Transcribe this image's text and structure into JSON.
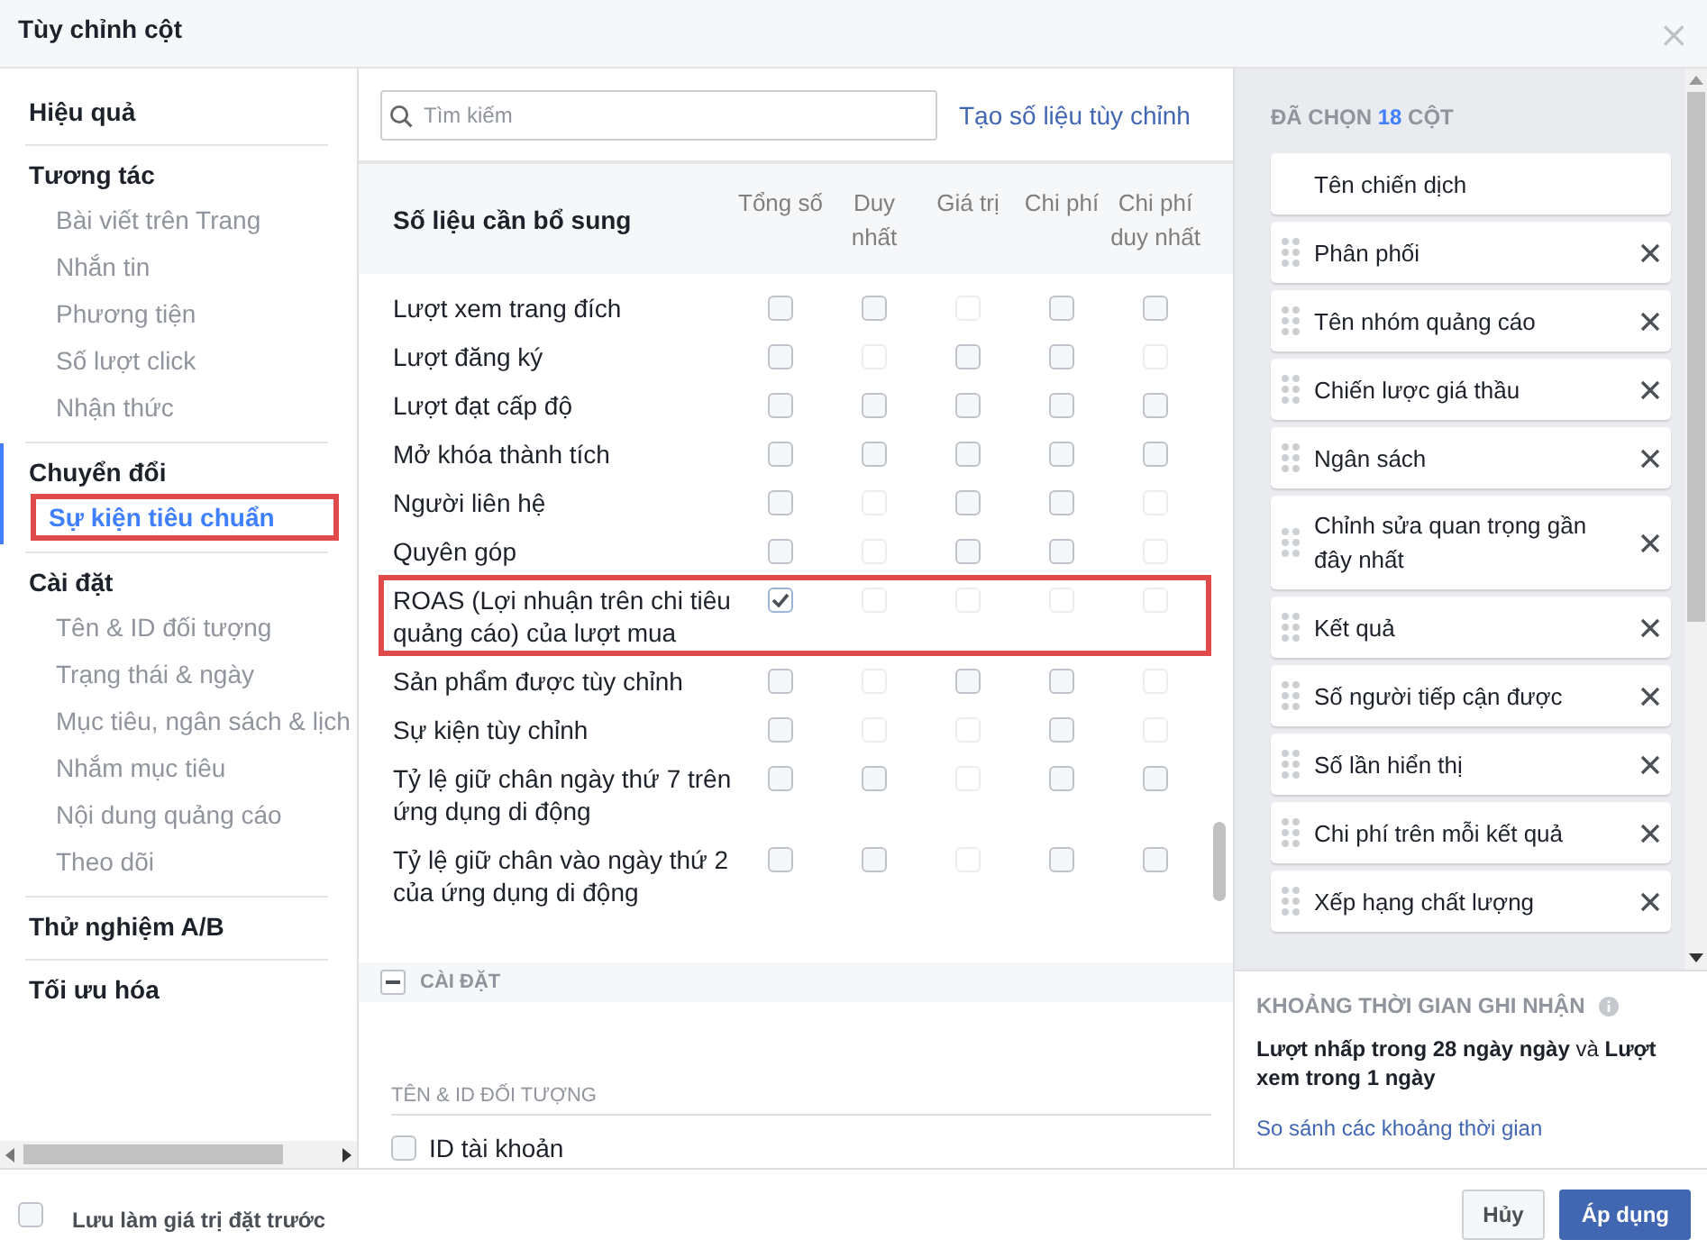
{
  "window": {
    "title": "Tùy chỉnh cột",
    "close": "×"
  },
  "sidebar": {
    "groups": [
      {
        "label": "Hiệu quả"
      },
      {
        "label": "Tương tác",
        "items": [
          {
            "label": "Bài viết trên Trang",
            "selected": false,
            "highlighted": false
          },
          {
            "label": "Nhắn tin",
            "selected": false,
            "highlighted": false
          },
          {
            "label": "Phương tiện",
            "selected": false,
            "highlighted": false
          },
          {
            "label": "Số lượt click",
            "selected": false,
            "highlighted": false
          },
          {
            "label": "Nhận thức",
            "selected": false,
            "highlighted": false
          }
        ]
      },
      {
        "label": "Chuyển đổi",
        "items": [
          {
            "label": "Sự kiện tiêu chuẩn",
            "selected": true,
            "highlighted": true
          }
        ]
      },
      {
        "label": "Cài đặt",
        "items": [
          {
            "label": "Tên & ID đối tượng",
            "selected": false,
            "highlighted": false
          },
          {
            "label": "Trạng thái & ngày",
            "selected": false,
            "highlighted": false
          },
          {
            "label": "Mục tiêu, ngân sách & lịch",
            "selected": false,
            "highlighted": false
          },
          {
            "label": "Nhắm mục tiêu",
            "selected": false,
            "highlighted": false
          },
          {
            "label": "Nội dung quảng cáo",
            "selected": false,
            "highlighted": false
          },
          {
            "label": "Theo dõi",
            "selected": false,
            "highlighted": false
          }
        ]
      },
      {
        "label": "Thử nghiệm A/B"
      },
      {
        "label": "Tối ưu hóa"
      }
    ]
  },
  "search": {
    "placeholder": "Tìm kiếm",
    "create_link": "Tạo số liệu tùy chỉnh"
  },
  "table": {
    "title": "Số liệu cần bổ sung",
    "columns": [
      "Tổng số",
      "Duy nhất",
      "Giá trị",
      "Chi phí",
      "Chi phí duy nhất"
    ],
    "rows": [
      {
        "label": "Lượt xem trang đích",
        "highlighted": false,
        "cells": [
          {
            "checked": false,
            "disabled": false
          },
          {
            "checked": false,
            "disabled": false
          },
          {
            "checked": false,
            "disabled": true
          },
          {
            "checked": false,
            "disabled": false
          },
          {
            "checked": false,
            "disabled": false
          }
        ]
      },
      {
        "label": "Lượt đăng ký",
        "highlighted": false,
        "cells": [
          {
            "checked": false,
            "disabled": false
          },
          {
            "checked": false,
            "disabled": true
          },
          {
            "checked": false,
            "disabled": false
          },
          {
            "checked": false,
            "disabled": false
          },
          {
            "checked": false,
            "disabled": true
          }
        ]
      },
      {
        "label": "Lượt đạt cấp độ",
        "highlighted": false,
        "cells": [
          {
            "checked": false,
            "disabled": false
          },
          {
            "checked": false,
            "disabled": false
          },
          {
            "checked": false,
            "disabled": false
          },
          {
            "checked": false,
            "disabled": false
          },
          {
            "checked": false,
            "disabled": false
          }
        ]
      },
      {
        "label": "Mở khóa thành tích",
        "highlighted": false,
        "cells": [
          {
            "checked": false,
            "disabled": false
          },
          {
            "checked": false,
            "disabled": false
          },
          {
            "checked": false,
            "disabled": false
          },
          {
            "checked": false,
            "disabled": false
          },
          {
            "checked": false,
            "disabled": false
          }
        ]
      },
      {
        "label": "Người liên hệ",
        "highlighted": false,
        "cells": [
          {
            "checked": false,
            "disabled": false
          },
          {
            "checked": false,
            "disabled": true
          },
          {
            "checked": false,
            "disabled": false
          },
          {
            "checked": false,
            "disabled": false
          },
          {
            "checked": false,
            "disabled": true
          }
        ]
      },
      {
        "label": "Quyên góp",
        "highlighted": false,
        "cells": [
          {
            "checked": false,
            "disabled": false
          },
          {
            "checked": false,
            "disabled": true
          },
          {
            "checked": false,
            "disabled": false
          },
          {
            "checked": false,
            "disabled": false
          },
          {
            "checked": false,
            "disabled": true
          }
        ]
      },
      {
        "label": "ROAS (Lợi nhuận trên chi tiêu quảng cáo) của lượt mua",
        "highlighted": true,
        "cells": [
          {
            "checked": true,
            "disabled": false
          },
          {
            "checked": false,
            "disabled": true
          },
          {
            "checked": false,
            "disabled": true
          },
          {
            "checked": false,
            "disabled": true
          },
          {
            "checked": false,
            "disabled": true
          }
        ]
      },
      {
        "label": "Sản phẩm được tùy chỉnh",
        "highlighted": false,
        "cells": [
          {
            "checked": false,
            "disabled": false
          },
          {
            "checked": false,
            "disabled": true
          },
          {
            "checked": false,
            "disabled": false
          },
          {
            "checked": false,
            "disabled": false
          },
          {
            "checked": false,
            "disabled": true
          }
        ]
      },
      {
        "label": "Sự kiện tùy chỉnh",
        "highlighted": false,
        "cells": [
          {
            "checked": false,
            "disabled": false
          },
          {
            "checked": false,
            "disabled": true
          },
          {
            "checked": false,
            "disabled": true
          },
          {
            "checked": false,
            "disabled": false
          },
          {
            "checked": false,
            "disabled": true
          }
        ]
      },
      {
        "label": "Tỷ lệ giữ chân ngày thứ 7 trên ứng dụng di động",
        "highlighted": false,
        "cells": [
          {
            "checked": false,
            "disabled": false
          },
          {
            "checked": false,
            "disabled": false
          },
          {
            "checked": false,
            "disabled": true
          },
          {
            "checked": false,
            "disabled": false
          },
          {
            "checked": false,
            "disabled": false
          }
        ]
      },
      {
        "label": "Tỷ lệ giữ chân vào ngày thứ 2 của ứng dụng di động",
        "highlighted": false,
        "cells": [
          {
            "checked": false,
            "disabled": false
          },
          {
            "checked": false,
            "disabled": false
          },
          {
            "checked": false,
            "disabled": true
          },
          {
            "checked": false,
            "disabled": false
          },
          {
            "checked": false,
            "disabled": false
          }
        ]
      }
    ]
  },
  "section": {
    "title": "CÀI ĐẶT",
    "expanded": true,
    "subheading": "TÊN & ID ĐỐI TƯỢNG",
    "options": [
      {
        "label": "ID tài khoản",
        "checked": false
      }
    ]
  },
  "selected_columns": {
    "prefix": "ĐÃ CHỌN",
    "count": "18",
    "suffix": "CỘT",
    "items": [
      {
        "label": "Tên chiến dịch",
        "removable": false
      },
      {
        "label": "Phân phối",
        "removable": true
      },
      {
        "label": "Tên nhóm quảng cáo",
        "removable": true
      },
      {
        "label": "Chiến lược giá thầu",
        "removable": true
      },
      {
        "label": "Ngân sách",
        "removable": true
      },
      {
        "label": "Chỉnh sửa quan trọng gần đây nhất",
        "removable": true
      },
      {
        "label": "Kết quả",
        "removable": true
      },
      {
        "label": "Số người tiếp cận được",
        "removable": true
      },
      {
        "label": "Số lần hiển thị",
        "removable": true
      },
      {
        "label": "Chi phí trên mỗi kết quả",
        "removable": true
      },
      {
        "label": "Xếp hạng chất lượng",
        "removable": true
      }
    ]
  },
  "attribution": {
    "title": "KHOẢNG THỜI GIAN GHI NHẬN",
    "text": "**Lượt nhấp trong 28 ngày ngày** và **Lượt xem trong 1 ngày**",
    "link": "So sánh các khoảng thời gian"
  },
  "footer": {
    "save_preset": {
      "label": "Lưu làm giá trị đặt trước",
      "checked": false
    },
    "buttons": [
      {
        "label": "Hủy",
        "kind": "secondary"
      },
      {
        "label": "Áp dụng",
        "kind": "primary"
      }
    ]
  }
}
